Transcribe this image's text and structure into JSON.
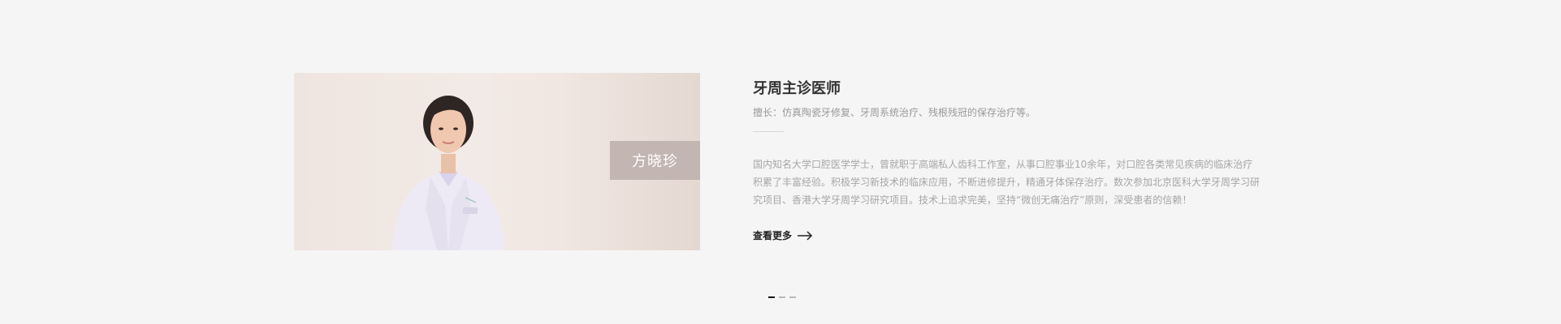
{
  "doctor": {
    "name": "方晓珍",
    "title": "牙周主诊医师",
    "specialty": "擅长：仿真陶瓷牙修复、牙周系统治疗、残根残冠的保存治疗等。",
    "bio": "国内知名大学口腔医学学士，曾就职于高端私人齿科工作室，从事口腔事业10余年，对口腔各类常见疾病的临床治疗积累了丰富经验。积极学习新技术的临床应用，不断进修提升，精通牙体保存治疗。数次参加北京医科大学牙周学习研究项目、香港大学牙周学习研究项目。技术上追求完美，坚持“微创无痛治疗”原则，深受患者的信赖！"
  },
  "more_link": {
    "label": "查看更多"
  },
  "pagination": {
    "count": 3,
    "active_index": 0
  },
  "colors": {
    "background": "#f5f5f5",
    "name_box": "#c2b5b2",
    "active_dot": "#111111",
    "inactive_dot": "#b8b8b8"
  }
}
